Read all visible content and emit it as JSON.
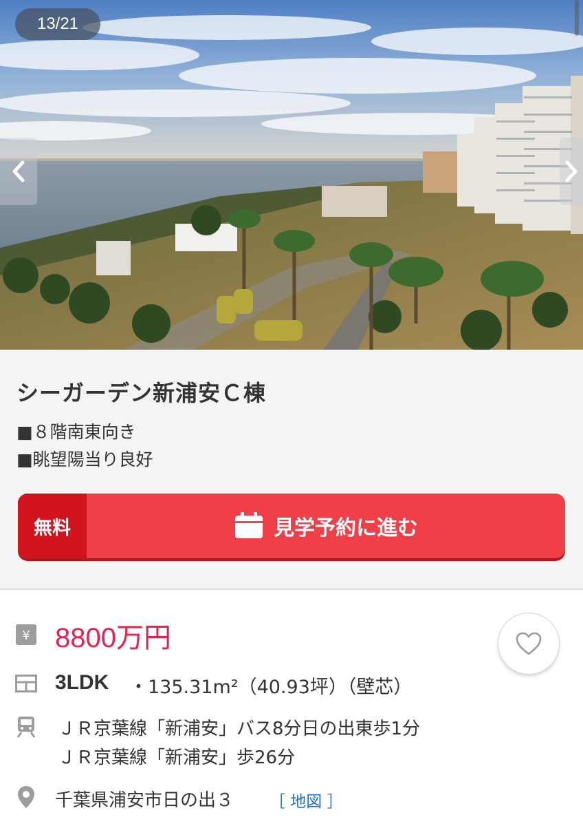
{
  "gallery": {
    "counter": "13/21",
    "prev_icon": "chevron-left-icon",
    "next_icon": "chevron-right-icon"
  },
  "listing": {
    "title": "シーガーデン新浦安Ｃ棟",
    "features": [
      "■８階南東向き",
      "■眺望陽当り良好"
    ]
  },
  "cta": {
    "free_label": "無料",
    "label": "見学予約に進む",
    "icon": "calendar-icon"
  },
  "details": {
    "price": "8800万円",
    "layout": "3LDK",
    "area": "・135.31m²（40.93坪）（壁芯）",
    "access": [
      "ＪＲ京葉線「新浦安」バス8分日の出東歩1分",
      "ＪＲ京葉線「新浦安」歩26分"
    ],
    "address": "千葉県浦安市日の出３",
    "map_link": "［ 地図 ］",
    "favorite_icon": "heart-icon"
  },
  "colors": {
    "accent_red": "#ef3f48",
    "free_badge_red": "#d0131d",
    "price_pink": "#e6224f",
    "link_blue": "#1f6fd1"
  }
}
